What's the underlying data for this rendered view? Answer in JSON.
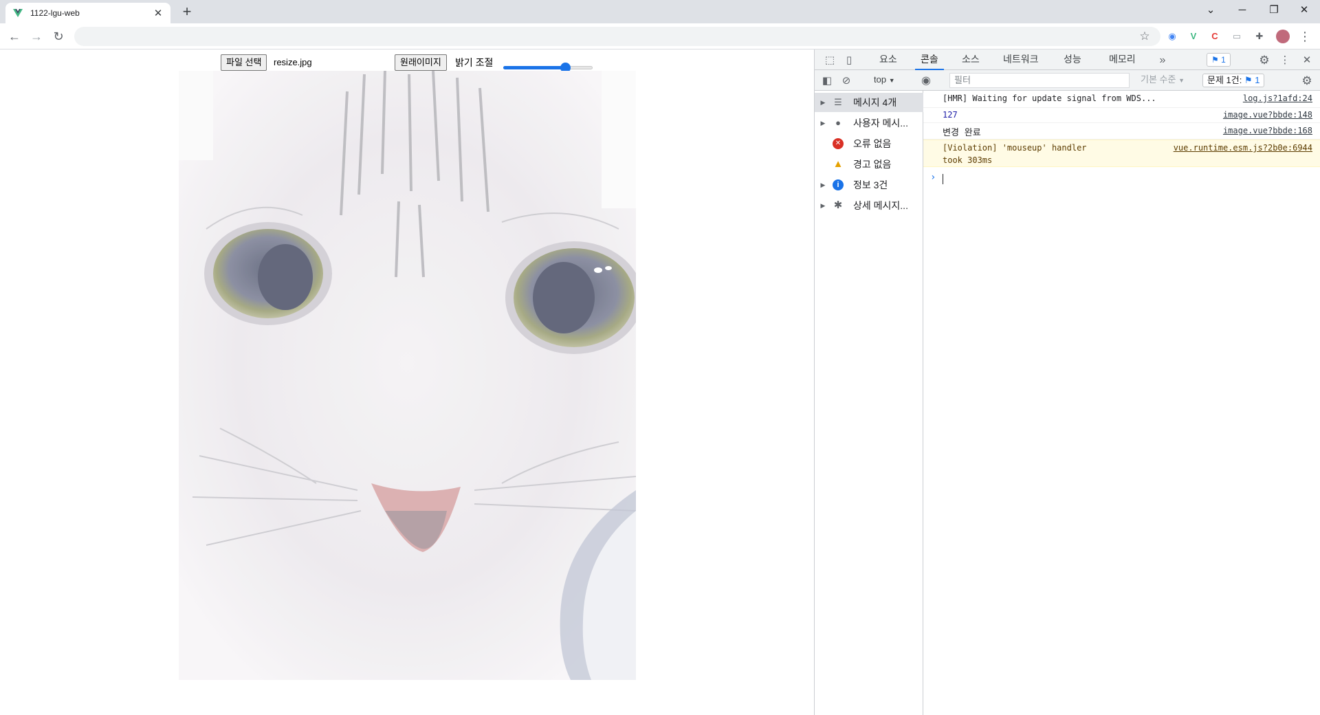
{
  "browser": {
    "tab_title": "1122-lgu-web",
    "tab_close": "✕",
    "new_tab": "+",
    "window_controls": [
      "⌄",
      "─",
      "❐",
      "✕"
    ],
    "nav": {
      "back": "←",
      "forward": "→",
      "reload": "↻"
    },
    "address": "",
    "bookmark_star": "☆",
    "extensions": [
      {
        "icon": "chrome-color-ext-icon",
        "glyph": "◉",
        "color": "#4285f4"
      },
      {
        "icon": "vue-devtools-icon",
        "glyph": "V",
        "color": "#41b883"
      },
      {
        "icon": "red-c-ext-icon",
        "glyph": "C",
        "color": "#e53935"
      },
      {
        "icon": "cast-ext-icon",
        "glyph": "▭",
        "color": "#9aa0a6"
      },
      {
        "icon": "puzzle-extensions-icon",
        "glyph": "✚",
        "color": "#5f6368"
      }
    ],
    "menu": "⋮"
  },
  "page": {
    "file_button": "파일 선택",
    "file_name": "resize.jpg",
    "original_button": "원래이미지",
    "brightness_label": "밝기 조절",
    "brightness_level": 0.72
  },
  "devtools": {
    "tabs": [
      "요소",
      "콘솔",
      "소스",
      "네트워크",
      "성능",
      "메모리"
    ],
    "active_tab": "콘솔",
    "more_tabs": "»",
    "issues_count": "1",
    "close": "✕",
    "menu": "⋮",
    "context": "top",
    "filter_placeholder": "필터",
    "level": "기본 수준",
    "issues_label": "문제 1건:",
    "issues_label_count": "1",
    "sidebar": [
      {
        "label": "메시지 4개",
        "icon": "list-icon",
        "glyph": "☰",
        "color": "#5f6368",
        "expandable": true,
        "selected": true
      },
      {
        "label": "사용자 메시...",
        "icon": "user-icon",
        "glyph": "●",
        "color": "#5f6368",
        "expandable": true,
        "selected": false
      },
      {
        "label": "오류 없음",
        "icon": "error-icon",
        "glyph": "✕",
        "color": "#d93025",
        "expandable": false,
        "selected": false
      },
      {
        "label": "경고 없음",
        "icon": "warning-icon",
        "glyph": "▲",
        "color": "#e5a100",
        "expandable": false,
        "selected": false
      },
      {
        "label": "정보 3건",
        "icon": "info-icon",
        "glyph": "i",
        "color": "#1a73e8",
        "expandable": true,
        "selected": false
      },
      {
        "label": "상세 메시지...",
        "icon": "bug-icon",
        "glyph": "✱",
        "color": "#5f6368",
        "expandable": true,
        "selected": false
      }
    ],
    "messages": [
      {
        "text": "[HMR] Waiting for update signal from WDS...",
        "source": "log.js?1afd:24",
        "kind": "log"
      },
      {
        "text": "127",
        "source": "image.vue?bbde:148",
        "kind": "number"
      },
      {
        "text": "변경 완료",
        "source": "image.vue?bbde:168",
        "kind": "log"
      },
      {
        "text": "[Violation] 'mouseup' handler\ntook 303ms",
        "source": "vue.runtime.esm.js?2b0e:6944",
        "kind": "warn"
      }
    ],
    "prompt": "›"
  }
}
